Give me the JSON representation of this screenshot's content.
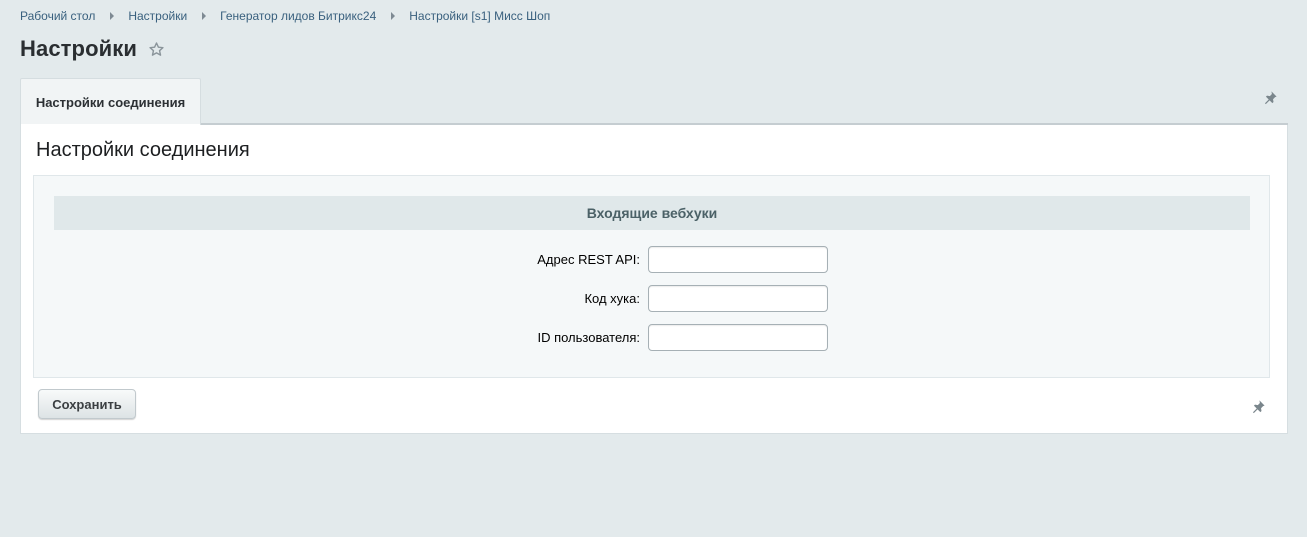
{
  "breadcrumb": {
    "items": [
      "Рабочий стол",
      "Настройки",
      "Генератор лидов Битрикс24",
      "Настройки [s1] Мисс Шоп"
    ]
  },
  "page": {
    "title": "Настройки"
  },
  "tabs": [
    {
      "label": "Настройки соединения",
      "active": true
    }
  ],
  "panel": {
    "section_title": "Настройки соединения",
    "group_title": "Входящие вебхуки",
    "fields": [
      {
        "label": "Адрес REST API:",
        "value": ""
      },
      {
        "label": "Код хука:",
        "value": ""
      },
      {
        "label": "ID пользователя:",
        "value": ""
      }
    ],
    "save_label": "Сохранить"
  },
  "colors": {
    "background": "#e3eaec",
    "link": "#39607e",
    "group_header_bg": "#e0e8ea",
    "form_bg": "#f5f8f9"
  },
  "icons": {
    "favorite": "star-icon",
    "pin": "pin-icon"
  }
}
